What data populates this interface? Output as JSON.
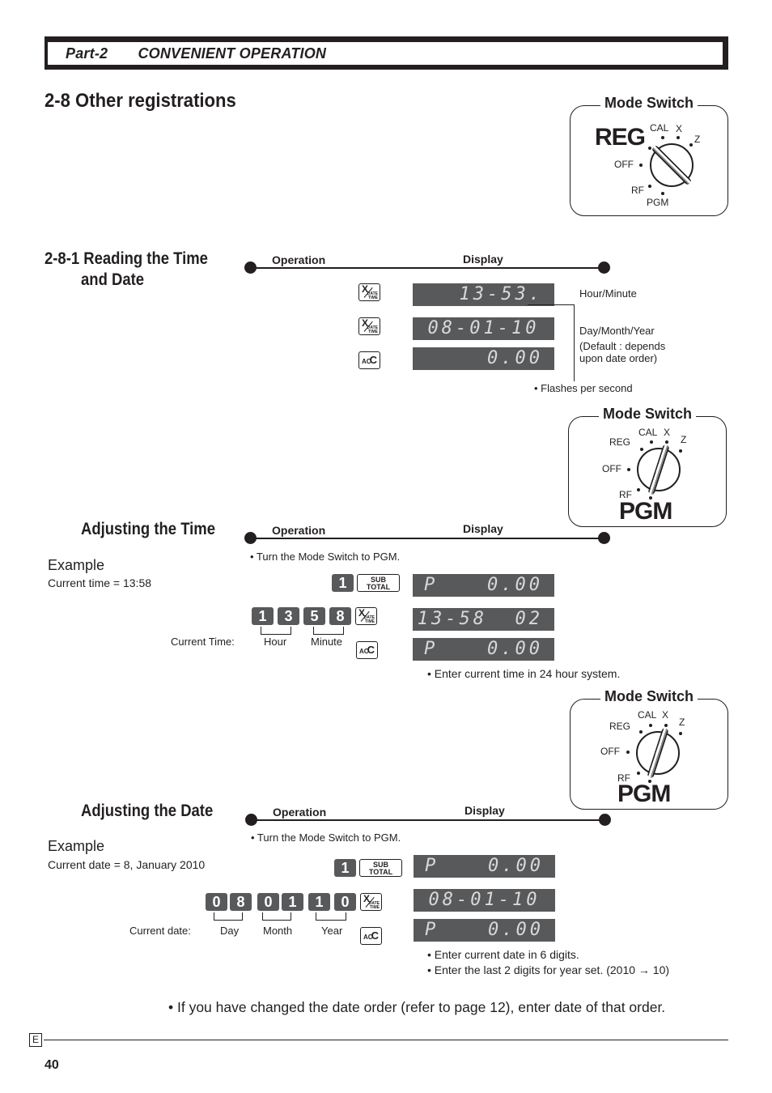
{
  "header": {
    "part": "Part-2",
    "title": "CONVENIENT OPERATION"
  },
  "section": {
    "title": "2-8  Other registrations"
  },
  "mode_switch_common": {
    "title": "Mode Switch",
    "positions": [
      "REG",
      "CAL",
      "X",
      "Z",
      "OFF",
      "RF",
      "PGM"
    ]
  },
  "mode_switch_1": {
    "title": "Mode Switch",
    "selected": "REG",
    "cal": "CAL",
    "x": "X",
    "z": "Z",
    "off": "OFF",
    "rf": "RF",
    "pgm": "PGM",
    "reg": "REG"
  },
  "mode_switch_2": {
    "title": "Mode Switch",
    "selected": "PGM",
    "cal": "CAL",
    "x": "X",
    "z": "Z",
    "off": "OFF",
    "rf": "RF",
    "pgm": "PGM",
    "reg": "REG"
  },
  "mode_switch_3": {
    "title": "Mode Switch",
    "selected": "PGM",
    "cal": "CAL",
    "x": "X",
    "z": "Z",
    "off": "OFF",
    "rf": "RF",
    "pgm": "PGM",
    "reg": "REG"
  },
  "columns": {
    "operation": "Operation",
    "display": "Display"
  },
  "keys": {
    "xdt_x": "X",
    "xdt_date": "DATE",
    "xdt_time": "TIME",
    "ac_a": "AC",
    "ac_c": "C",
    "sub1": "SUB",
    "sub2": "TOTAL"
  },
  "reading": {
    "title_line1": "2-8-1  Reading the Time",
    "title_line2": "and Date",
    "displays": [
      "13-53.",
      "08-01-10",
      "0.00"
    ],
    "notes": {
      "hour_minute": "Hour/Minute",
      "dmy": "Day/Month/Year",
      "default1": "(Default : depends",
      "default2": "upon date order)",
      "flashes": "•  Flashes per second"
    }
  },
  "adjust_time": {
    "title": "Adjusting the Time",
    "example_label": "Example",
    "example_text": "Current time = 13:58",
    "instruction": "• Turn the Mode Switch to PGM.",
    "first_key": "1",
    "digits": [
      "1",
      "3",
      "5",
      "8"
    ],
    "caption": "Current  Time:",
    "group1": "Hour",
    "group2": "Minute",
    "displays": [
      {
        "left": "P",
        "right": "0.00"
      },
      {
        "left": "",
        "right": "13-58  02"
      },
      {
        "left": "P",
        "right": "0.00"
      }
    ],
    "note": "• Enter current time in 24 hour system."
  },
  "adjust_date": {
    "title": "Adjusting the Date",
    "example_label": "Example",
    "example_text": "Current date = 8, January 2010",
    "instruction": "• Turn the Mode Switch to PGM.",
    "first_key": "1",
    "digits": [
      "0",
      "8",
      "0",
      "1",
      "1",
      "0"
    ],
    "caption": "Current  date:",
    "group1": "Day",
    "group2": "Month",
    "group3": "Year",
    "displays": [
      {
        "left": "P",
        "right": "0.00"
      },
      {
        "left": "",
        "right": "08-01-10"
      },
      {
        "left": "P",
        "right": "0.00"
      }
    ],
    "note1": "• Enter current date in 6 digits.",
    "note2": "• Enter the last 2 digits for year set. (2010 → 10)"
  },
  "footnote": "• If you have changed the date order (refer to page 12), enter date of that order.",
  "footer": {
    "lang": "E",
    "page": "40"
  }
}
